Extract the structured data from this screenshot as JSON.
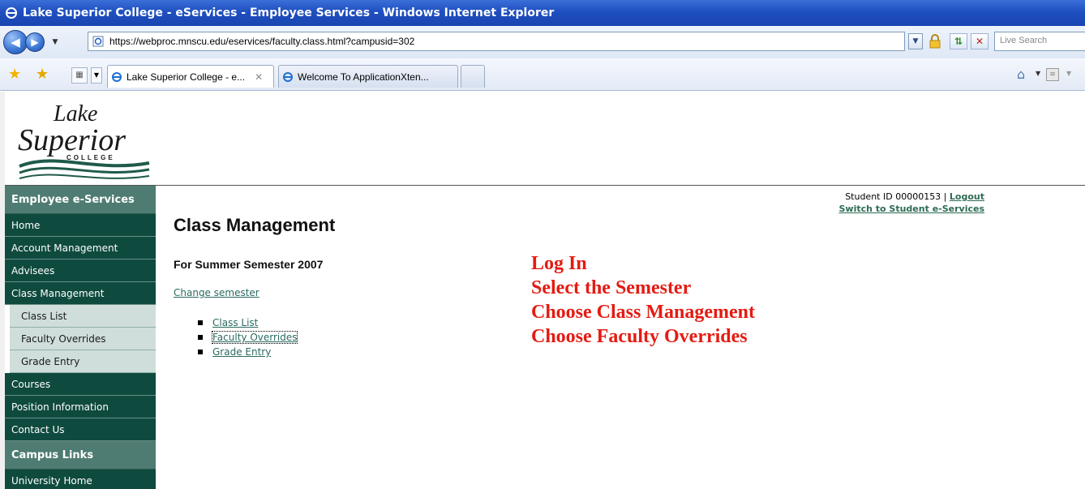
{
  "window": {
    "title": "Lake Superior College - eServices - Employee Services - Windows Internet Explorer"
  },
  "toolbar": {
    "url": "https://webproc.mnscu.edu/eservices/faculty.class.html?campusid=302",
    "search_placeholder": "Live Search"
  },
  "tabs": [
    {
      "label": "Lake Superior College - e...",
      "active": true
    },
    {
      "label": "Welcome To ApplicationXten...",
      "active": false
    }
  ],
  "logo": {
    "line1": "Lake",
    "line2": "Superior",
    "line3": "COLLEGE"
  },
  "sidebar": {
    "header": "Employee e-Services",
    "items": [
      {
        "label": "Home"
      },
      {
        "label": "Account Management"
      },
      {
        "label": "Advisees"
      },
      {
        "label": "Class Management"
      }
    ],
    "subitems": [
      {
        "label": "Class List"
      },
      {
        "label": "Faculty Overrides"
      },
      {
        "label": "Grade Entry"
      }
    ],
    "items2": [
      {
        "label": "Courses"
      },
      {
        "label": "Position Information"
      },
      {
        "label": "Contact Us"
      }
    ],
    "header2": "Campus Links",
    "items3": [
      {
        "label": "University Home"
      }
    ]
  },
  "user": {
    "student_id": "Student ID 00000153",
    "separator": "|",
    "logout": "Logout",
    "switch": "Switch to Student e-Services"
  },
  "main": {
    "title": "Class Management",
    "semester": "For Summer Semester 2007",
    "change_semester": "Change semester",
    "links": [
      "Class List",
      "Faculty Overrides",
      "Grade Entry"
    ]
  },
  "instructions": [
    "Log In",
    "Select the Semester",
    "Choose Class Management",
    "Choose Faculty Overrides"
  ],
  "colors": {
    "sidebar_bg": "#0f4a3f",
    "link": "#2a6a60",
    "instruction_red": "#e41b12"
  }
}
